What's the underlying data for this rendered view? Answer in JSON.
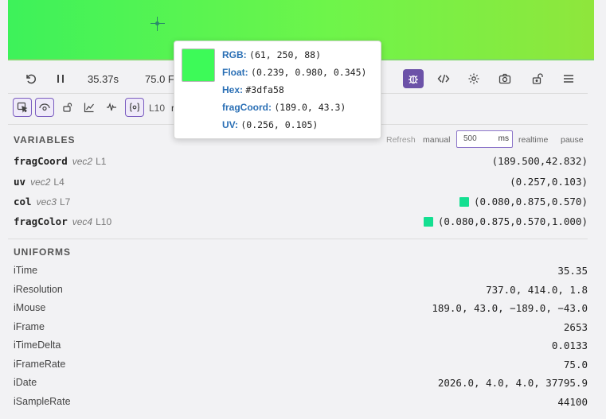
{
  "canvas": {
    "gradient_start": "#3df25a",
    "gradient_end": "#8fe63c"
  },
  "controls": {
    "time": "35.37s",
    "fps": "75.0 F",
    "icons": [
      "restart-icon",
      "pause-icon",
      "debug-bug-icon",
      "code-icon",
      "settings-icon",
      "camera-icon",
      "unlock-icon",
      "menu-icon"
    ],
    "accent": "#6c52a8"
  },
  "debug_toolbar": {
    "line_label": "L10",
    "trailing_char": "r",
    "icons": [
      "select-cursor-icon",
      "eye-icon",
      "lock-icon",
      "line-chart-icon",
      "waveform-icon",
      "variable-icon"
    ]
  },
  "tooltip": {
    "swatch_color": "#3dfa58",
    "rows": [
      {
        "key": "RGB:",
        "value": "(61, 250, 88)"
      },
      {
        "key": "Float:",
        "value": "(0.239, 0.980, 0.345)"
      },
      {
        "key": "Hex:",
        "value": "#3dfa58"
      },
      {
        "key": "fragCoord:",
        "value": "(189.0, 43.3)"
      },
      {
        "key": "UV:",
        "value": "(0.256, 0.105)"
      }
    ]
  },
  "variables": {
    "title": "VARIABLES",
    "refresh_label": "Refresh",
    "manual_label": "manual",
    "interval_value": "500",
    "interval_unit": "ms",
    "realtime_label": "realtime",
    "pause_label": "pause",
    "rows": [
      {
        "name": "fragCoord",
        "type": "vec2",
        "line": "L1",
        "value": "(189.500,42.832)",
        "swatch": ""
      },
      {
        "name": "uv",
        "type": "vec2",
        "line": "L4",
        "value": "(0.257,0.103)",
        "swatch": ""
      },
      {
        "name": "col",
        "type": "vec3",
        "line": "L7",
        "value": "(0.080,0.875,0.570)",
        "swatch": "#14df91"
      },
      {
        "name": "fragColor",
        "type": "vec4",
        "line": "L10",
        "value": "(0.080,0.875,0.570,1.000)",
        "swatch": "#14df91"
      }
    ]
  },
  "uniforms": {
    "title": "UNIFORMS",
    "rows": [
      {
        "name": "iTime",
        "value": "35.35"
      },
      {
        "name": "iResolution",
        "value": "737.0, 414.0, 1.8"
      },
      {
        "name": "iMouse",
        "value": "189.0, 43.0, −189.0, −43.0"
      },
      {
        "name": "iFrame",
        "value": "2653"
      },
      {
        "name": "iTimeDelta",
        "value": "0.0133"
      },
      {
        "name": "iFrameRate",
        "value": "75.0"
      },
      {
        "name": "iDate",
        "value": "2026.0, 4.0, 4.0, 37795.9"
      },
      {
        "name": "iSampleRate",
        "value": "44100"
      }
    ]
  }
}
